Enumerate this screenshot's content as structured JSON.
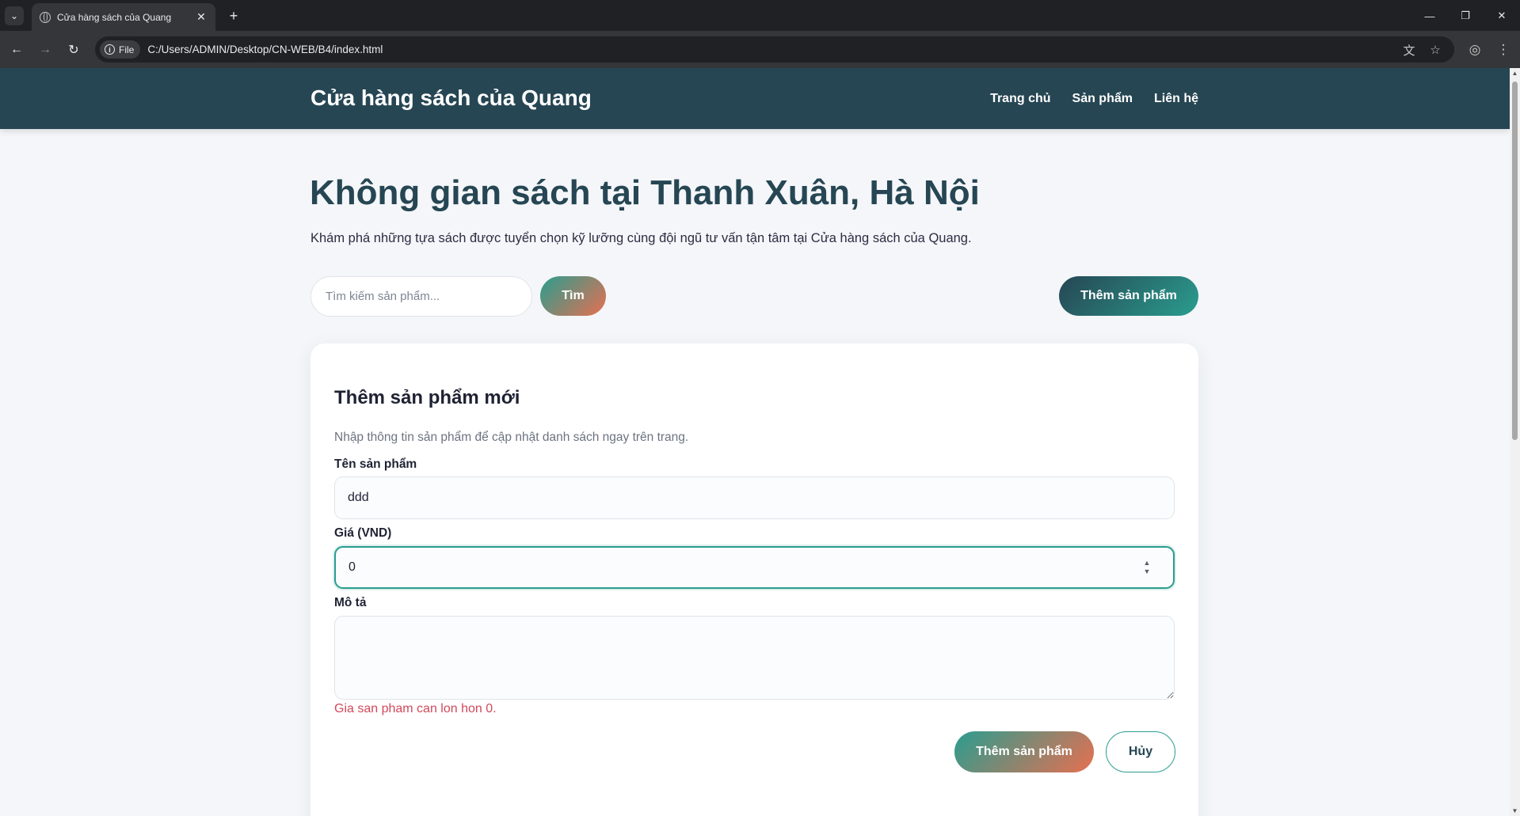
{
  "browser": {
    "tab_title": "Cửa hàng sách của Quang",
    "url_chip": "File",
    "url": "C:/Users/ADMIN/Desktop/CN-WEB/B4/index.html",
    "icons": [
      "tab-search-icon",
      "globe-icon",
      "close-icon",
      "plus-icon",
      "back-arrow-icon",
      "forward-arrow-icon",
      "reload-icon",
      "info-icon",
      "translate-icon",
      "star-icon",
      "profile-icon",
      "more-vertical-icon",
      "minimize-icon",
      "restore-icon",
      "window-close-icon"
    ]
  },
  "header": {
    "brand": "Cửa hàng sách của Quang",
    "nav": [
      {
        "label": "Trang chủ"
      },
      {
        "label": "Sản phẩm"
      },
      {
        "label": "Liên hệ"
      }
    ]
  },
  "hero": {
    "title": "Không gian sách tại Thanh Xuân, Hà Nội",
    "subtitle": "Khám phá những tựa sách được tuyển chọn kỹ lưỡng cùng đội ngũ tư vấn tận tâm tại Cửa hàng sách của Quang."
  },
  "search": {
    "placeholder": "Tìm kiếm sản phẩm...",
    "button_label": "Tìm",
    "add_button_label": "Thêm sản phẩm"
  },
  "form": {
    "title": "Thêm sản phẩm mới",
    "description": "Nhập thông tin sản phẩm để cập nhật danh sách ngay trên trang.",
    "name_label": "Tên sản phẩm",
    "name_value": "ddd",
    "price_label": "Giá (VND)",
    "price_value": "0",
    "desc_label": "Mô tả",
    "desc_value": "",
    "error": "Gia san pham can lon hon 0.",
    "submit_label": "Thêm sản phẩm",
    "cancel_label": "Hủy"
  },
  "colors": {
    "header_bg": "#264653",
    "accent_teal": "#2a9d8f",
    "accent_orange": "#e76f51",
    "error": "#d1495b",
    "page_bg": "#f4f6f9"
  }
}
